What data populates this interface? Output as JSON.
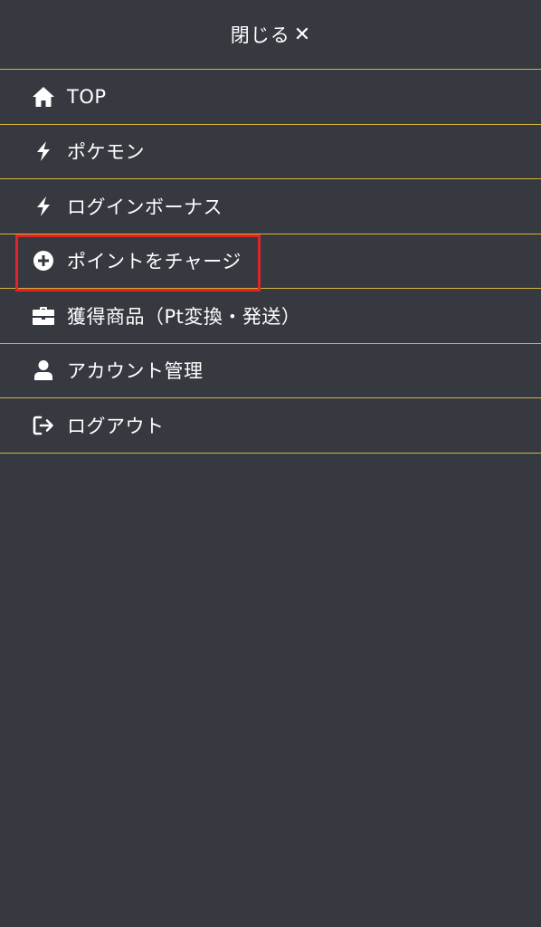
{
  "header": {
    "close_label": "閉じる",
    "close_symbol": "✕"
  },
  "menu": {
    "items": [
      {
        "label": "TOP",
        "icon": "home-icon"
      },
      {
        "label": "ポケモン",
        "icon": "bolt-icon"
      },
      {
        "label": "ログインボーナス",
        "icon": "bolt-icon"
      },
      {
        "label": "ポイントをチャージ",
        "icon": "plus-circle-icon"
      },
      {
        "label": "獲得商品（Pt変換・発送）",
        "icon": "briefcase-icon"
      },
      {
        "label": "アカウント管理",
        "icon": "user-icon"
      },
      {
        "label": "ログアウト",
        "icon": "logout-icon"
      }
    ]
  },
  "colors": {
    "background": "#363940",
    "divider": "#d4b43a",
    "highlight": "#e0242a",
    "text": "#ffffff"
  }
}
